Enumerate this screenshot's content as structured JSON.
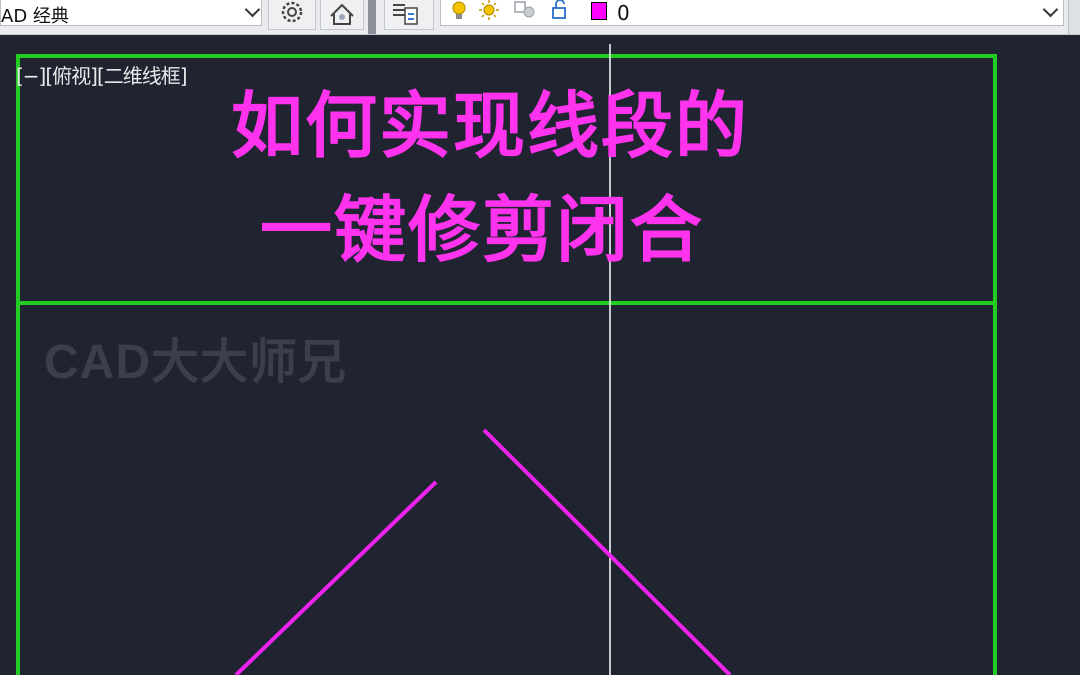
{
  "toolbar": {
    "workspace_value": "AD 经典",
    "layer_value": "0",
    "colors": {
      "layer_swatch": "#ff00ff",
      "bulb": "#f5c400",
      "sun": "#f5c400"
    }
  },
  "viewport": {
    "label": "[−][俯视][二维线框]"
  },
  "slide": {
    "title_line1": "如何实现线段的",
    "title_line2": "一键修剪闭合",
    "watermark": "CAD大大师兄",
    "colors": {
      "frame": "#22cc22",
      "lines": "#ee22ee",
      "title": "#ff33ee",
      "background": "#1f2430"
    }
  }
}
